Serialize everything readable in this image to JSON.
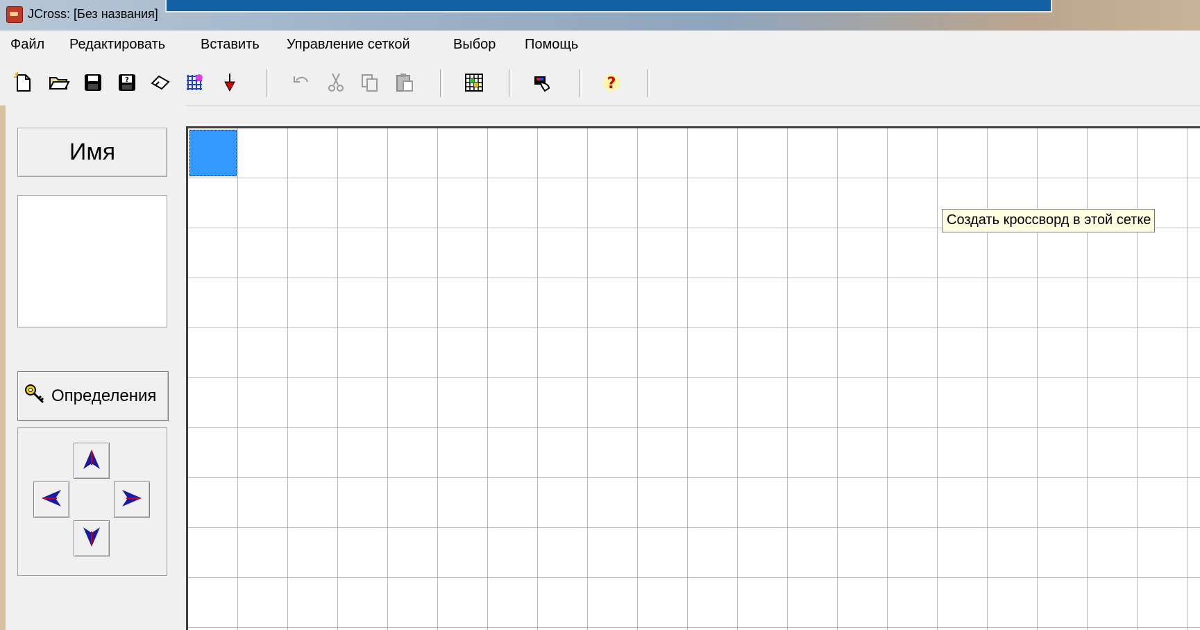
{
  "window": {
    "title": "JCross: [Без названия]"
  },
  "menu": {
    "items": [
      "Файл",
      "Редактировать",
      "Вставить",
      "Управление сеткой",
      "Выбор",
      "Помощь"
    ]
  },
  "toolbar": {
    "buttons": [
      {
        "icon": "new-file-icon",
        "enabled": true
      },
      {
        "icon": "open-folder-icon",
        "enabled": true
      },
      {
        "icon": "save-icon",
        "enabled": true
      },
      {
        "icon": "save-as-icon",
        "enabled": true
      },
      {
        "icon": "eraser-icon",
        "enabled": true
      },
      {
        "icon": "create-grid-icon",
        "enabled": true
      },
      {
        "icon": "down-arrow-icon",
        "enabled": true
      },
      {
        "icon": "undo-icon",
        "enabled": false
      },
      {
        "icon": "cut-icon",
        "enabled": false
      },
      {
        "icon": "copy-icon",
        "enabled": false
      },
      {
        "icon": "paste-icon",
        "enabled": false
      },
      {
        "icon": "make-crossword-icon",
        "enabled": true
      },
      {
        "icon": "config-icon",
        "enabled": true
      },
      {
        "icon": "help-icon",
        "enabled": true
      }
    ]
  },
  "left_panel": {
    "name_button": "Имя",
    "definitions_button": "Определения"
  },
  "tooltip": {
    "text": "Создать кроссворд в этой сетке"
  },
  "colors": {
    "selected_cell": "#3399ff",
    "tooltip_bg": "#ffffe1",
    "arrow_fill": "#1a1aa8",
    "arrow_accent": "#d40000"
  }
}
